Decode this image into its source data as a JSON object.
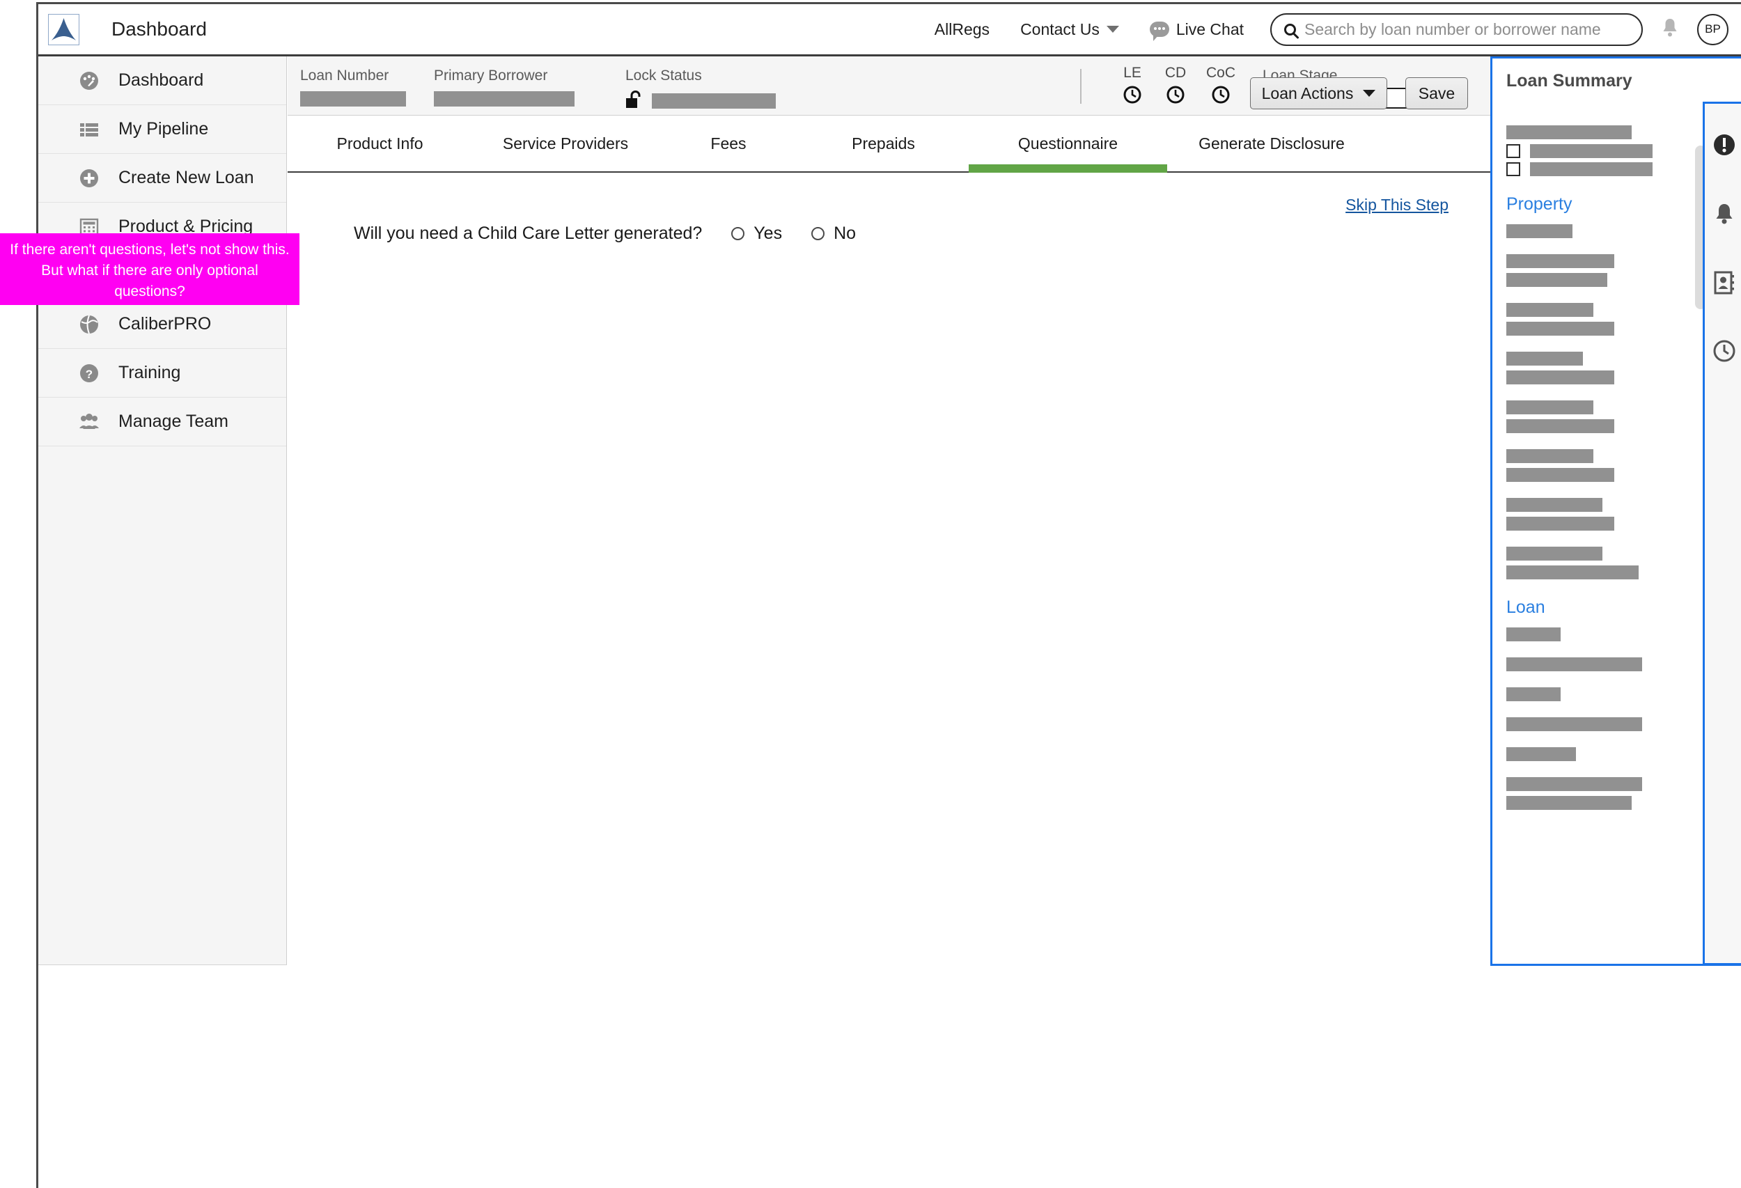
{
  "topbar": {
    "app_title": "Dashboard",
    "logo_icon": "mountain-logo-icon",
    "links": [
      {
        "label": "AllRegs",
        "icon": null,
        "caret": false
      },
      {
        "label": "Contact Us",
        "icon": null,
        "caret": true
      },
      {
        "label": "Live Chat",
        "icon": "chat-bubble-icon",
        "caret": false
      }
    ],
    "search": {
      "placeholder": "Search by loan number or borrower name",
      "value": "",
      "icon": "search-icon"
    },
    "notification_icon": "bell-icon",
    "avatar_initials": "BP"
  },
  "sidebar": {
    "items": [
      {
        "label": "Dashboard",
        "icon": "speedometer-icon"
      },
      {
        "label": "My Pipeline",
        "icon": "list-icon"
      },
      {
        "label": "Create New Loan",
        "icon": "plus-circle-icon"
      },
      {
        "label": "Product & Pricing",
        "icon": "calculator-icon"
      },
      {
        "label": "",
        "icon": "hidden-item-icon"
      },
      {
        "label": "CaliberPRO",
        "icon": "globe-icon"
      },
      {
        "label": "Training",
        "icon": "question-circle-icon"
      },
      {
        "label": "Manage Team",
        "icon": "people-icon"
      }
    ]
  },
  "loan_header": {
    "fields": [
      {
        "label": "Loan Number",
        "value_redacted": true
      },
      {
        "label": "Primary Borrower",
        "value_redacted": true
      },
      {
        "label": "Lock Status",
        "value_redacted": true,
        "icon": "unlock-icon"
      }
    ],
    "status_icons": [
      {
        "label": "LE",
        "icon": "clock-icon"
      },
      {
        "label": "CD",
        "icon": "clock-icon"
      },
      {
        "label": "CoC",
        "icon": "clock-icon"
      }
    ],
    "loan_stage": {
      "label": "Loan Stage",
      "value_redacted": true
    },
    "loan_actions_label": "Loan Actions",
    "save_label": "Save"
  },
  "tabs": [
    {
      "label": "Product Info",
      "active": false
    },
    {
      "label": "Service Providers",
      "active": false
    },
    {
      "label": "Fees",
      "active": false
    },
    {
      "label": "Prepaids",
      "active": false
    },
    {
      "label": "Questionnaire",
      "active": true
    },
    {
      "label": "Generate Disclosure",
      "active": false
    }
  ],
  "content": {
    "skip_link": "Skip This Step",
    "question": {
      "text": "Will you need a Child Care Letter generated?",
      "options": [
        {
          "label": "Yes",
          "selected": false
        },
        {
          "label": "No",
          "selected": false
        }
      ]
    }
  },
  "summary_panel": {
    "title": "Loan Summary",
    "top_rows": {
      "bar_widths": [
        180
      ],
      "checkbox_rows": [
        176,
        176
      ]
    },
    "groups": [
      {
        "heading": "Property",
        "bars": [
          95,
          155,
          145,
          125,
          155,
          110,
          155,
          125,
          155,
          125,
          155,
          138,
          155,
          138,
          190
        ]
      },
      {
        "heading": "Loan",
        "bars": [
          78,
          195,
          78,
          195,
          100,
          195,
          180
        ]
      }
    ]
  },
  "icon_rail": {
    "top_icon": "list-view-icon",
    "icons": [
      "alert-circle-icon",
      "bell-icon",
      "contact-book-icon",
      "clock-icon"
    ]
  },
  "annotation": {
    "text": "If there aren't questions, let's not show this. But what if there are only optional questions?",
    "color": "#ff00f2"
  }
}
